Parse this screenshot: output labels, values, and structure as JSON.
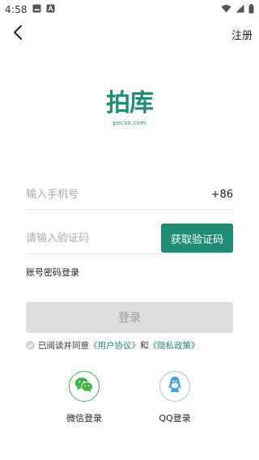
{
  "status_bar": {
    "time": "4:58",
    "icons": [
      "image-icon",
      "a-icon",
      "wifi-icon",
      "signal-icon",
      "battery-icon"
    ]
  },
  "top_bar": {
    "register_label": "注册"
  },
  "logo": {
    "mark": "拍库",
    "sub": "pecoo.com",
    "color": "#1f8c77"
  },
  "form": {
    "phone_placeholder": "输入手机号",
    "country_code": "+86",
    "code_placeholder": "请输入验证码",
    "get_code_label": "获取验证码",
    "password_login_label": "账号密码登录"
  },
  "login": {
    "label": "登录"
  },
  "agreement": {
    "prefix": "已阅读并同意",
    "user_agreement": "《用户协议》",
    "and": "和",
    "privacy_policy": "《隐私政策》"
  },
  "social": {
    "wechat_label": "微信登录",
    "qq_label": "QQ登录"
  },
  "colors": {
    "accent": "#1f8c77",
    "wechat": "#3bb24a",
    "qq": "#8fc8ec",
    "disabled_button": "#dcdcdc"
  }
}
